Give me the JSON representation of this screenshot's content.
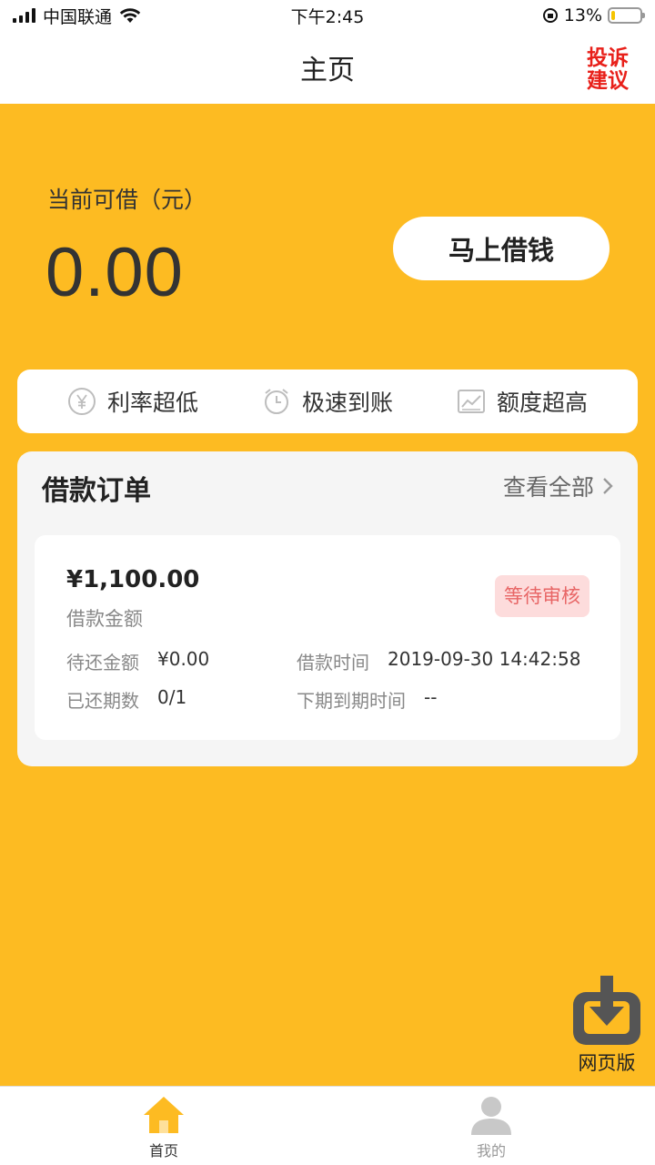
{
  "status_bar": {
    "carrier": "中国联通",
    "time": "下午2:45",
    "battery_text": "13%",
    "battery_level": 0.13
  },
  "nav": {
    "title": "主页",
    "complaint_line1": "投诉",
    "complaint_line2": "建议"
  },
  "hero": {
    "label": "当前可借（元）",
    "amount": "0.00",
    "borrow_button": "马上借钱"
  },
  "features": [
    {
      "icon": "yen-circle-icon",
      "label": "利率超低"
    },
    {
      "icon": "clock-icon",
      "label": "极速到账"
    },
    {
      "icon": "chart-line-icon",
      "label": "额度超高"
    }
  ],
  "orders": {
    "title": "借款订单",
    "view_all": "查看全部",
    "item": {
      "amount": "¥1,100.00",
      "amount_label": "借款金额",
      "status": "等待审核",
      "pending_label": "待还金额",
      "pending_value": "¥0.00",
      "borrow_time_label": "借款时间",
      "borrow_time_value": "2019-09-30 14:42:58",
      "periods_label": "已还期数",
      "periods_value": "0/1",
      "next_due_label": "下期到期时间",
      "next_due_value": "--"
    }
  },
  "fab": {
    "label": "网页版"
  },
  "tabs": [
    {
      "label": "首页",
      "active": true
    },
    {
      "label": "我的",
      "active": false
    }
  ],
  "colors": {
    "background": "#FDBB22",
    "complaint": "#E8201A",
    "badge_bg": "#FDDCDC",
    "badge_text": "#E86666",
    "tab_active": "#FDBB22",
    "tab_inactive": "#C8C8C8"
  }
}
